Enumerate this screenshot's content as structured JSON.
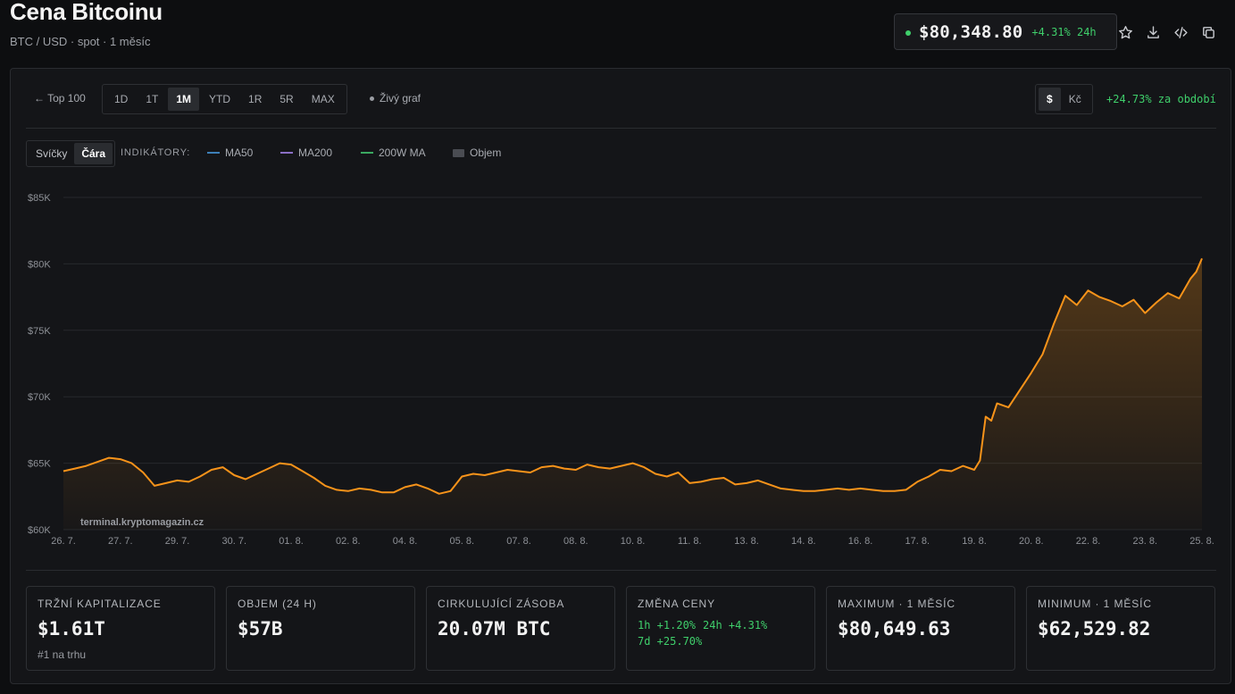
{
  "header": {
    "title": "Cena Bitcoinu",
    "subtitle": "BTC / USD · spot · 1 měsíc",
    "price": "$80,348.80",
    "change_24h": "+4.31% 24h"
  },
  "toolbar": {
    "back_label": "← Top 100",
    "ranges": [
      "1D",
      "1T",
      "1M",
      "YTD",
      "1R",
      "5R",
      "MAX"
    ],
    "active_range": "1M",
    "live_chart_label": "Živý graf",
    "currencies": [
      "$",
      "Kč"
    ],
    "active_currency": "$",
    "period_change": "+24.73% za období"
  },
  "indicators": {
    "chart_types": [
      "Svíčky",
      "Čára"
    ],
    "active_type": "Čára",
    "label": "INDIKÁTORY:",
    "items": [
      {
        "name": "MA50",
        "color": "#3d7fb8",
        "kind": "line"
      },
      {
        "name": "MA200",
        "color": "#8a6fc4",
        "kind": "line"
      },
      {
        "name": "200W MA",
        "color": "#3aa860",
        "kind": "line"
      },
      {
        "name": "Objem",
        "color": "#4a4c52",
        "kind": "box"
      }
    ]
  },
  "chart_data": {
    "type": "area",
    "line_color": "#f7931a",
    "watermark": "terminal.kryptomagazin.cz",
    "ylim": [
      60000,
      85000
    ],
    "y_ticks": [
      60000,
      65000,
      70000,
      75000,
      80000,
      85000
    ],
    "y_tick_labels": [
      "$60K",
      "$65K",
      "$70K",
      "$75K",
      "$80K",
      "$85K"
    ],
    "x_tick_labels": [
      "26. 7.",
      "27. 7.",
      "29. 7.",
      "30. 7.",
      "01. 8.",
      "02. 8.",
      "04. 8.",
      "05. 8.",
      "07. 8.",
      "08. 8.",
      "10. 8.",
      "11. 8.",
      "13. 8.",
      "14. 8.",
      "16. 8.",
      "17. 8.",
      "19. 8.",
      "20. 8.",
      "22. 8.",
      "23. 8.",
      "25. 8."
    ],
    "x_tick_positions": [
      0,
      1,
      2,
      3,
      4,
      5,
      6,
      7,
      8,
      9,
      10,
      11,
      12,
      13,
      14,
      15,
      16,
      17,
      18,
      19,
      20
    ],
    "xlim": [
      0,
      20
    ],
    "grid": true,
    "x": [
      0,
      0.2,
      0.4,
      0.6,
      0.8,
      1.0,
      1.2,
      1.4,
      1.6,
      1.8,
      2.0,
      2.2,
      2.4,
      2.6,
      2.8,
      3.0,
      3.2,
      3.4,
      3.6,
      3.8,
      4.0,
      4.2,
      4.4,
      4.6,
      4.8,
      5.0,
      5.2,
      5.4,
      5.6,
      5.8,
      6.0,
      6.2,
      6.4,
      6.6,
      6.8,
      7.0,
      7.2,
      7.4,
      7.6,
      7.8,
      8.0,
      8.2,
      8.4,
      8.6,
      8.8,
      9.0,
      9.2,
      9.4,
      9.6,
      9.8,
      10.0,
      10.2,
      10.4,
      10.6,
      10.8,
      11.0,
      11.2,
      11.4,
      11.6,
      11.8,
      12.0,
      12.2,
      12.4,
      12.6,
      12.8,
      13.0,
      13.2,
      13.4,
      13.6,
      13.8,
      14.0,
      14.2,
      14.4,
      14.6,
      14.8,
      15.0,
      15.2,
      15.4,
      15.6,
      15.8,
      16.0,
      16.1,
      16.2,
      16.3,
      16.4,
      16.6,
      16.8,
      17.0,
      17.1,
      17.2,
      17.4,
      17.6,
      17.8,
      18.0,
      18.2,
      18.4,
      18.6,
      18.8,
      19.0,
      19.2,
      19.4,
      19.6,
      19.8,
      19.9,
      20.0
    ],
    "y": [
      64400,
      64600,
      64800,
      65100,
      65400,
      65300,
      65000,
      64300,
      63300,
      63500,
      63700,
      63600,
      64000,
      64500,
      64700,
      64100,
      63800,
      64200,
      64600,
      65000,
      64900,
      64400,
      63900,
      63300,
      63000,
      62900,
      63100,
      63000,
      62800,
      62800,
      63200,
      63400,
      63100,
      62700,
      62900,
      64000,
      64200,
      64100,
      64300,
      64500,
      64400,
      64300,
      64700,
      64800,
      64600,
      64500,
      64900,
      64700,
      64600,
      64800,
      65000,
      64700,
      64200,
      64000,
      64300,
      63500,
      63600,
      63800,
      63900,
      63400,
      63500,
      63700,
      63400,
      63100,
      63000,
      62900,
      62900,
      63000,
      63100,
      63000,
      63100,
      63000,
      62900,
      62900,
      63000,
      63600,
      64000,
      64500,
      64400,
      64800,
      64500,
      65200,
      68500,
      68200,
      69500,
      69200,
      70500,
      71800,
      72500,
      73200,
      75500,
      77600,
      76900,
      78000,
      77500,
      77200,
      76800,
      77300,
      76300,
      77100,
      77800,
      77400,
      78900,
      79400,
      80400
    ]
  },
  "stats": [
    {
      "label": "TRŽNÍ KAPITALIZACE",
      "value": "$1.61T",
      "sub": "#1 na trhu"
    },
    {
      "label": "OBJEM (24 H)",
      "value": "$57B"
    },
    {
      "label": "CIRKULUJÍCÍ ZÁSOBA",
      "value": "20.07M BTC"
    },
    {
      "label": "ZMĚNA CENY",
      "changes": [
        "1h +1.20%",
        "24h +4.31%",
        "7d +25.70%"
      ]
    },
    {
      "label": "MAXIMUM · 1 MĚSÍC",
      "value": "$80,649.63"
    },
    {
      "label": "MINIMUM · 1 MĚSÍC",
      "value": "$62,529.82"
    }
  ]
}
